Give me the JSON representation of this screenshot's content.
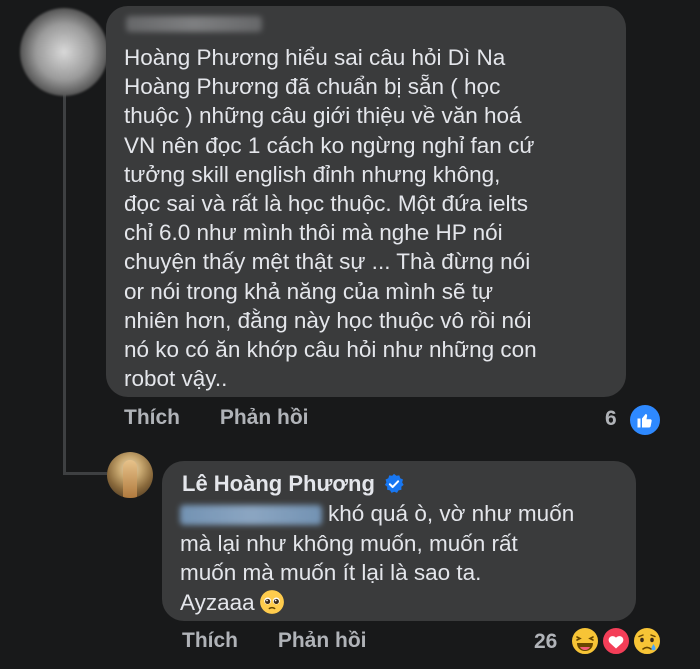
{
  "comment1": {
    "text_lines": [
      "Hoàng Phương hiểu sai câu hỏi Dì Na",
      "Hoàng Phương đã chuẩn bị sẵn ( học",
      "thuộc ) những câu giới thiệu về văn hoá",
      "VN nên đọc 1 cách ko ngừng nghỉ fan cứ",
      "tưởng skill english đỉnh nhưng không,",
      "đọc sai và rất là học thuộc. Một đứa ielts",
      "chỉ 6.0 như mình thôi mà nghe HP nói",
      "chuyện thấy mệt thật sự ... Thà đừng nói",
      "or nói trong khả năng của mình sẽ tự",
      "nhiên hơn, đằng này học thuộc vô rồi nói",
      "nó ko có ăn khớp câu hỏi như những con",
      "robot vậy.."
    ],
    "like_label": "Thích",
    "reply_label": "Phản hồi",
    "reaction_count": "6",
    "reaction_icon": "thumbs-up-icon"
  },
  "comment2": {
    "author": "Lê Hoàng Phương",
    "verified_icon": "verified-badge-icon",
    "text_lines": [
      "khó quá ò, vờ như muốn",
      "mà lại như không muốn, muốn rất",
      "muốn mà muốn ít lại là sao ta.",
      "Ayzaaa"
    ],
    "inline_emoji": "pleading-face-icon",
    "like_label": "Thích",
    "reply_label": "Phản hồi",
    "reaction_count": "26",
    "reaction_icons": [
      "haha-icon",
      "love-icon",
      "sad-icon"
    ]
  },
  "colors": {
    "background": "#18191a",
    "bubble": "#3a3b3c",
    "text": "#e4e6eb",
    "secondary_text": "#b0b3b8",
    "like_blue": "#2e89ff"
  }
}
